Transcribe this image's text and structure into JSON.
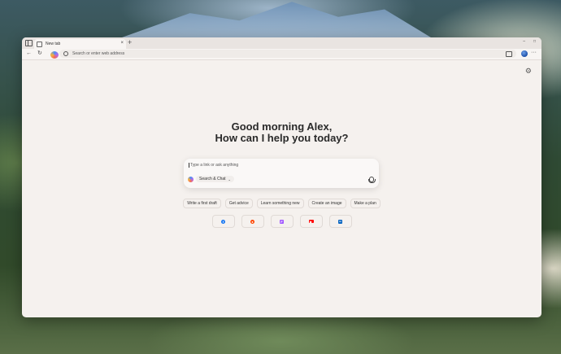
{
  "tab": {
    "title": "New tab",
    "close": "×",
    "new_tab": "+"
  },
  "window": {
    "minimize": "–",
    "maximize": "□"
  },
  "toolbar": {
    "back": "←",
    "reload": "↻",
    "address_placeholder": "Search or enter web address",
    "menu": "···"
  },
  "page": {
    "settings": "⚙",
    "greeting_line1": "Good morning Alex,",
    "greeting_line2": "How can I help you today?",
    "prompt_placeholder": "Type a link or ask anything",
    "mode_label": "Search & Chat",
    "mode_chevron": "⌄"
  },
  "suggestions": [
    "Write a first draft",
    "Get advice",
    "Learn something new",
    "Create an image",
    "Make a plan"
  ],
  "shortcuts": [
    {
      "name": "facebook",
      "glyph": "f",
      "color": "#1877f2"
    },
    {
      "name": "reddit",
      "glyph": "●",
      "color": "#ff4500"
    },
    {
      "name": "figma",
      "glyph": "F",
      "color": "#a259ff"
    },
    {
      "name": "youtube",
      "glyph": "▶",
      "color": "#ff0000"
    },
    {
      "name": "linkedin",
      "glyph": "in",
      "color": "#0a66c2"
    }
  ]
}
